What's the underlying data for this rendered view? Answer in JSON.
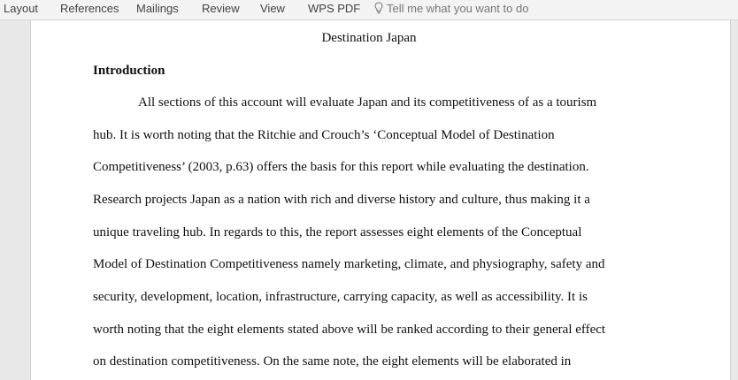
{
  "ribbon": {
    "tabs": [
      "Layout",
      "References",
      "Mailings",
      "Review",
      "View",
      "WPS PDF"
    ],
    "tell_me": "Tell me what you want to do"
  },
  "document": {
    "title": "Destination Japan",
    "heading": "Introduction",
    "lines": [
      "All sections of this account will evaluate Japan and its competitiveness of as a tourism",
      "hub. It is worth noting that the Ritchie and Crouch’s ‘Conceptual Model of Destination",
      "Competitiveness’ (2003, p.63) offers the basis for this report while evaluating the destination.",
      "Research projects Japan as a nation with rich and diverse history and culture, thus making it a",
      "unique traveling hub. In regards to this, the report assesses eight elements of the Conceptual",
      "Model of Destination Competitiveness namely marketing, climate, and physiography, safety and",
      "security, development, location, infrastructure, carrying capacity, as well as accessibility. It is",
      "worth noting that the eight elements stated above will be ranked according to their general effect",
      "on destination competitiveness. On the same note, the eight elements will be elaborated in"
    ]
  }
}
